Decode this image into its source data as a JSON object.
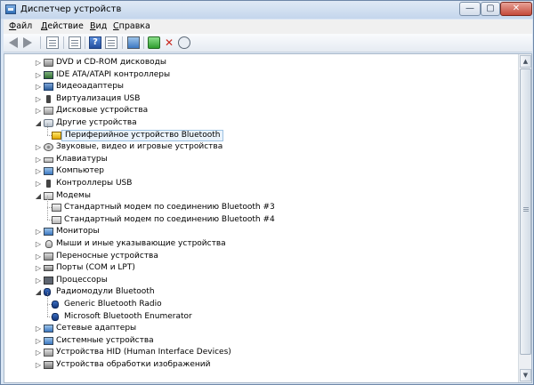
{
  "window": {
    "title": "Диспетчер устройств"
  },
  "menu": [
    {
      "label": "Файл",
      "u": "Ф",
      "rest": "айл"
    },
    {
      "label": "Действие",
      "u": "Д",
      "rest": "ействие"
    },
    {
      "label": "Вид",
      "u": "В",
      "rest": "ид"
    },
    {
      "label": "Справка",
      "u": "С",
      "rest": "правка"
    }
  ],
  "toolbar": {
    "help_glyph": "?",
    "uninstall_glyph": "✕"
  },
  "colors": {
    "selection": "#eaf3fb",
    "titlebar": "#c4d6ec",
    "accent": "#3c78c2"
  },
  "tree": [
    {
      "label": "DVD и CD-ROM дисководы",
      "icon": "dvd-drive-icon",
      "expander": "collapsed"
    },
    {
      "label": "IDE ATA/ATAPI контроллеры",
      "icon": "ide-controller-icon",
      "expander": "collapsed"
    },
    {
      "label": "Видеоадаптеры",
      "icon": "display-adapter-icon",
      "expander": "collapsed"
    },
    {
      "label": "Виртуализация USB",
      "icon": "usb-virtualization-icon",
      "expander": "collapsed"
    },
    {
      "label": "Дисковые устройства",
      "icon": "disk-drive-icon",
      "expander": "collapsed"
    },
    {
      "label": "Другие устройства",
      "icon": "unknown-device-icon",
      "expander": "expanded"
    },
    {
      "label": "Периферийное устройство Bluetooth",
      "icon": "warning-device-icon",
      "child": true,
      "selected": true
    },
    {
      "label": "Звуковые, видео и игровые устройства",
      "icon": "sound-device-icon",
      "expander": "collapsed"
    },
    {
      "label": "Клавиатуры",
      "icon": "keyboard-icon",
      "expander": "collapsed"
    },
    {
      "label": "Компьютер",
      "icon": "computer-icon",
      "expander": "collapsed"
    },
    {
      "label": "Контроллеры USB",
      "icon": "usb-controller-icon",
      "expander": "collapsed"
    },
    {
      "label": "Модемы",
      "icon": "modem-icon",
      "expander": "expanded"
    },
    {
      "label": "Стандартный модем по соединению Bluetooth #3",
      "icon": "modem-icon",
      "child": true
    },
    {
      "label": "Стандартный модем по соединению Bluetooth #4",
      "icon": "modem-icon",
      "child": true
    },
    {
      "label": "Мониторы",
      "icon": "monitor-icon",
      "expander": "collapsed"
    },
    {
      "label": "Мыши и иные указывающие устройства",
      "icon": "mouse-icon",
      "expander": "collapsed"
    },
    {
      "label": "Переносные устройства",
      "icon": "portable-device-icon",
      "expander": "collapsed"
    },
    {
      "label": "Порты (COM и LPT)",
      "icon": "port-icon",
      "expander": "collapsed"
    },
    {
      "label": "Процессоры",
      "icon": "processor-icon",
      "expander": "collapsed"
    },
    {
      "label": "Радиомодули Bluetooth",
      "icon": "bluetooth-icon",
      "expander": "expanded"
    },
    {
      "label": "Generic Bluetooth Radio",
      "icon": "bluetooth-icon",
      "child": true
    },
    {
      "label": "Microsoft Bluetooth Enumerator",
      "icon": "bluetooth-icon",
      "child": true
    },
    {
      "label": "Сетевые адаптеры",
      "icon": "network-adapter-icon",
      "expander": "collapsed"
    },
    {
      "label": "Системные устройства",
      "icon": "system-device-icon",
      "expander": "collapsed"
    },
    {
      "label": "Устройства HID (Human Interface Devices)",
      "icon": "hid-device-icon",
      "expander": "collapsed"
    },
    {
      "label": "Устройства обработки изображений",
      "icon": "imaging-device-icon",
      "expander": "collapsed"
    }
  ]
}
